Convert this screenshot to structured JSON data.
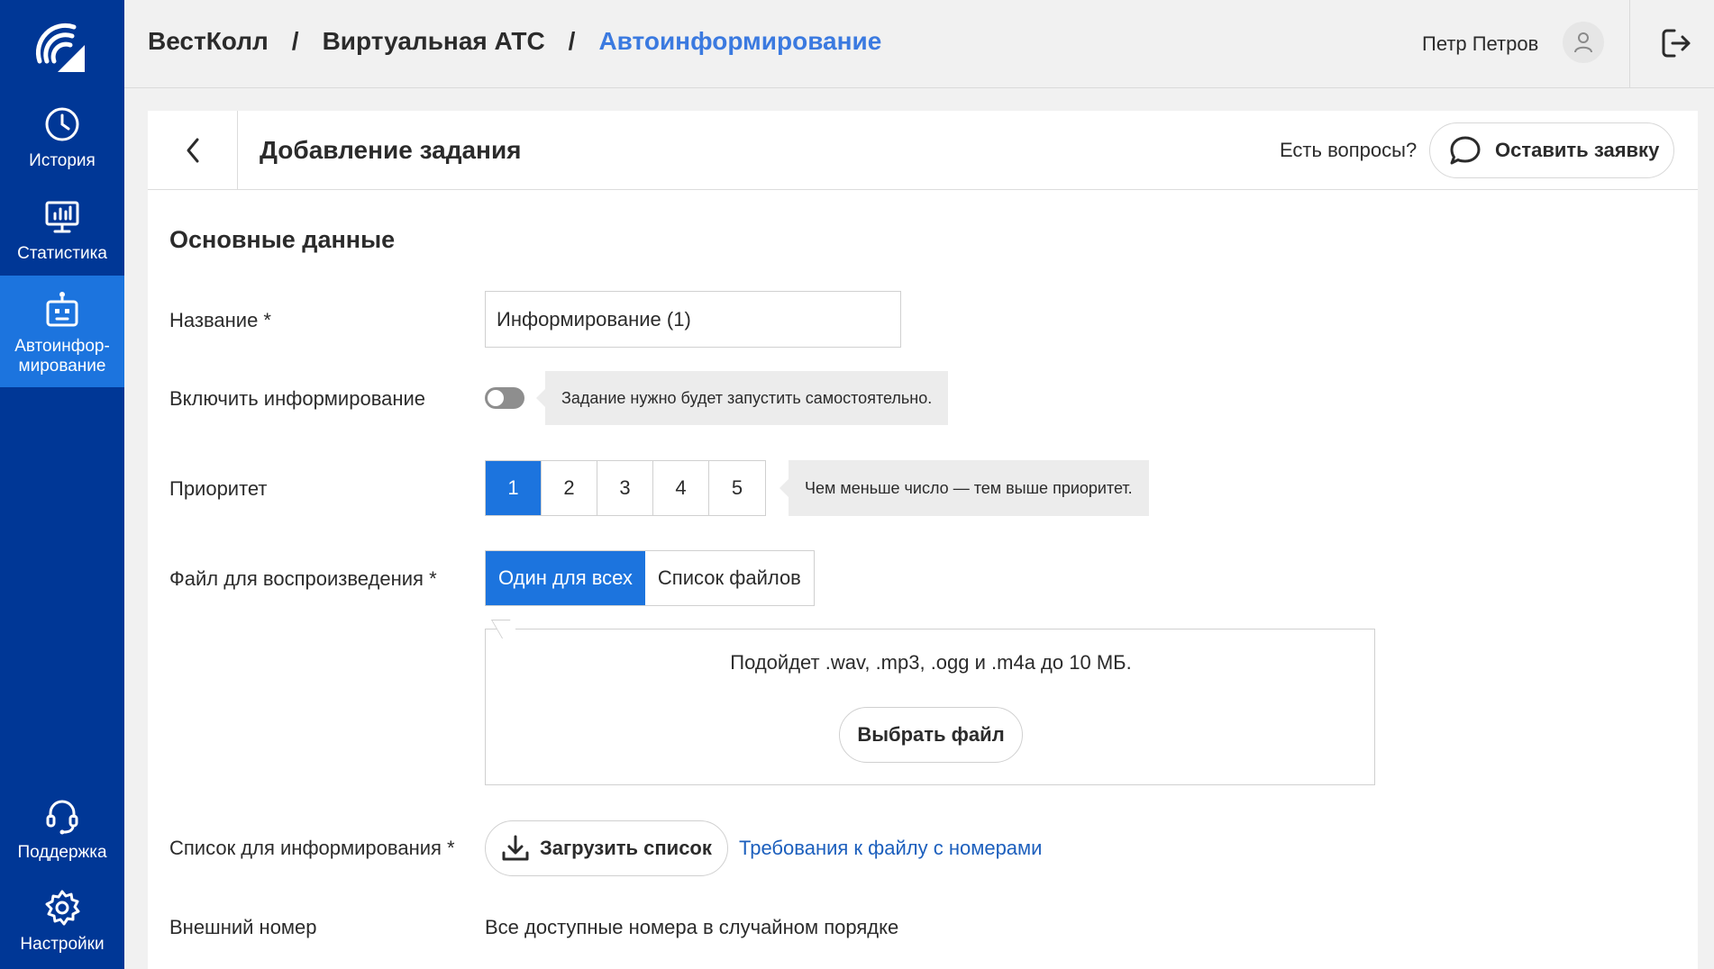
{
  "sidebar": {
    "items": [
      {
        "label": "История",
        "icon": "clock-icon"
      },
      {
        "label": "Статистика",
        "icon": "chart-monitor-icon"
      },
      {
        "label": "Автоинфор-\nмирование",
        "icon": "robot-icon",
        "active": true
      },
      {
        "label": "Поддержка",
        "icon": "headset-icon"
      },
      {
        "label": "Настройки",
        "icon": "gear-icon"
      }
    ]
  },
  "header": {
    "breadcrumb": [
      "ВестКолл",
      "Виртуальная АТС",
      "Автоинформирование"
    ],
    "separator": "/",
    "user_name": "Петр Петров"
  },
  "card": {
    "title": "Добавление задания",
    "questions_text": "Есть вопросы?",
    "request_button": "Оставить заявку"
  },
  "form": {
    "section_title": "Основные данные",
    "name": {
      "label": "Название *",
      "value": "Информирование (1)"
    },
    "enable": {
      "label": "Включить информирование",
      "enabled": false,
      "hint": "Задание нужно будет запустить самостоятельно."
    },
    "priority": {
      "label": "Приоритет",
      "options": [
        "1",
        "2",
        "3",
        "4",
        "5"
      ],
      "selected": "1",
      "hint": "Чем меньше число — тем выше приоритет."
    },
    "file": {
      "label": "Файл для воспроизведения *",
      "options": [
        "Один для всех",
        "Список файлов"
      ],
      "selected": "Один для всех",
      "dropzone_text": "Подойдет .wav, .mp3, .ogg и .m4a до 10 МБ.",
      "choose_button": "Выбрать файл"
    },
    "list": {
      "label": "Список для информирования *",
      "upload_button": "Загрузить список",
      "requirements_link": "Требования к файлу с номерами"
    },
    "external_number": {
      "label": "Внешний номер",
      "value": "Все доступные номера в случайном порядке"
    }
  },
  "colors": {
    "sidebar": "#003796",
    "accent": "#1c74de",
    "link": "#1c5fbd",
    "breadcrumb_current": "#3b7ae0"
  }
}
